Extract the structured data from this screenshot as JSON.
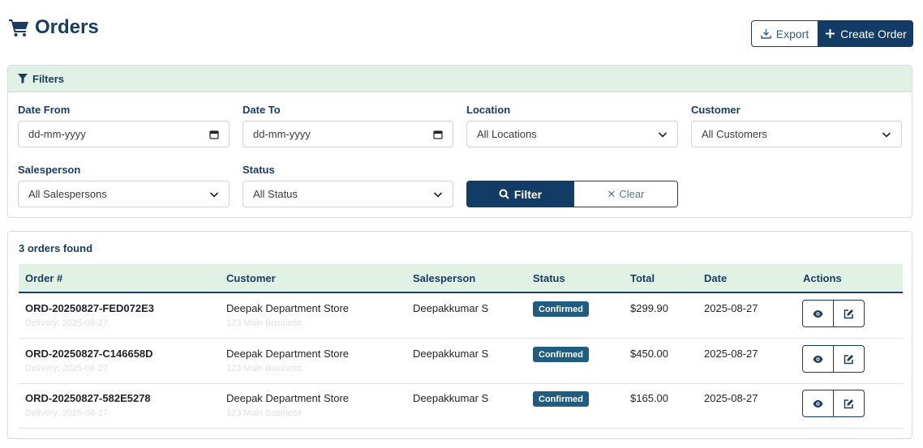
{
  "page": {
    "title": "Orders",
    "icons": {
      "title": "cart-icon",
      "export": "download-icon",
      "create": "plus-icon"
    }
  },
  "toolbar": {
    "export_label": "Export",
    "create_label": "Create Order"
  },
  "filters": {
    "header": "Filters",
    "date_from": {
      "label": "Date From",
      "placeholder": "dd-mm-yyyy"
    },
    "date_to": {
      "label": "Date To",
      "placeholder": "dd-mm-yyyy"
    },
    "location": {
      "label": "Location",
      "value": "All Locations"
    },
    "customer": {
      "label": "Customer",
      "value": "All Customers"
    },
    "salesperson": {
      "label": "Salesperson",
      "value": "All Salespersons"
    },
    "status": {
      "label": "Status",
      "value": "All Status"
    },
    "filter_button": "Filter",
    "clear_button": "Clear",
    "clear_symbol": "✕"
  },
  "orders": {
    "count_text": "3 orders found",
    "columns": [
      "Order #",
      "Customer",
      "Salesperson",
      "Status",
      "Total",
      "Date",
      "Actions"
    ],
    "rows": [
      {
        "order_no": "ORD-20250827-FED072E3",
        "sub1": "Delivery: 2025-08-27",
        "customer": "Deepak Department Store",
        "sub2": "123 Main Business",
        "salesperson": "Deepakkumar S",
        "status": "Confirmed",
        "total": "$299.90",
        "date": "2025-08-27"
      },
      {
        "order_no": "ORD-20250827-C146658D",
        "sub1": "Delivery: 2025-08-27",
        "customer": "Deepak Department Store",
        "sub2": "123 Main Business",
        "salesperson": "Deepakkumar S",
        "status": "Confirmed",
        "total": "$450.00",
        "date": "2025-08-27"
      },
      {
        "order_no": "ORD-20250827-582E5278",
        "sub1": "Delivery: 2025-08-27",
        "customer": "Deepak Department Store",
        "sub2": "123 Main Business",
        "salesperson": "Deepakkumar S",
        "status": "Confirmed",
        "total": "$165.00",
        "date": "2025-08-27"
      }
    ]
  },
  "colors": {
    "primary": "#123b66",
    "header_bg": "#dff2e5",
    "badge": "#1f5c7f"
  }
}
